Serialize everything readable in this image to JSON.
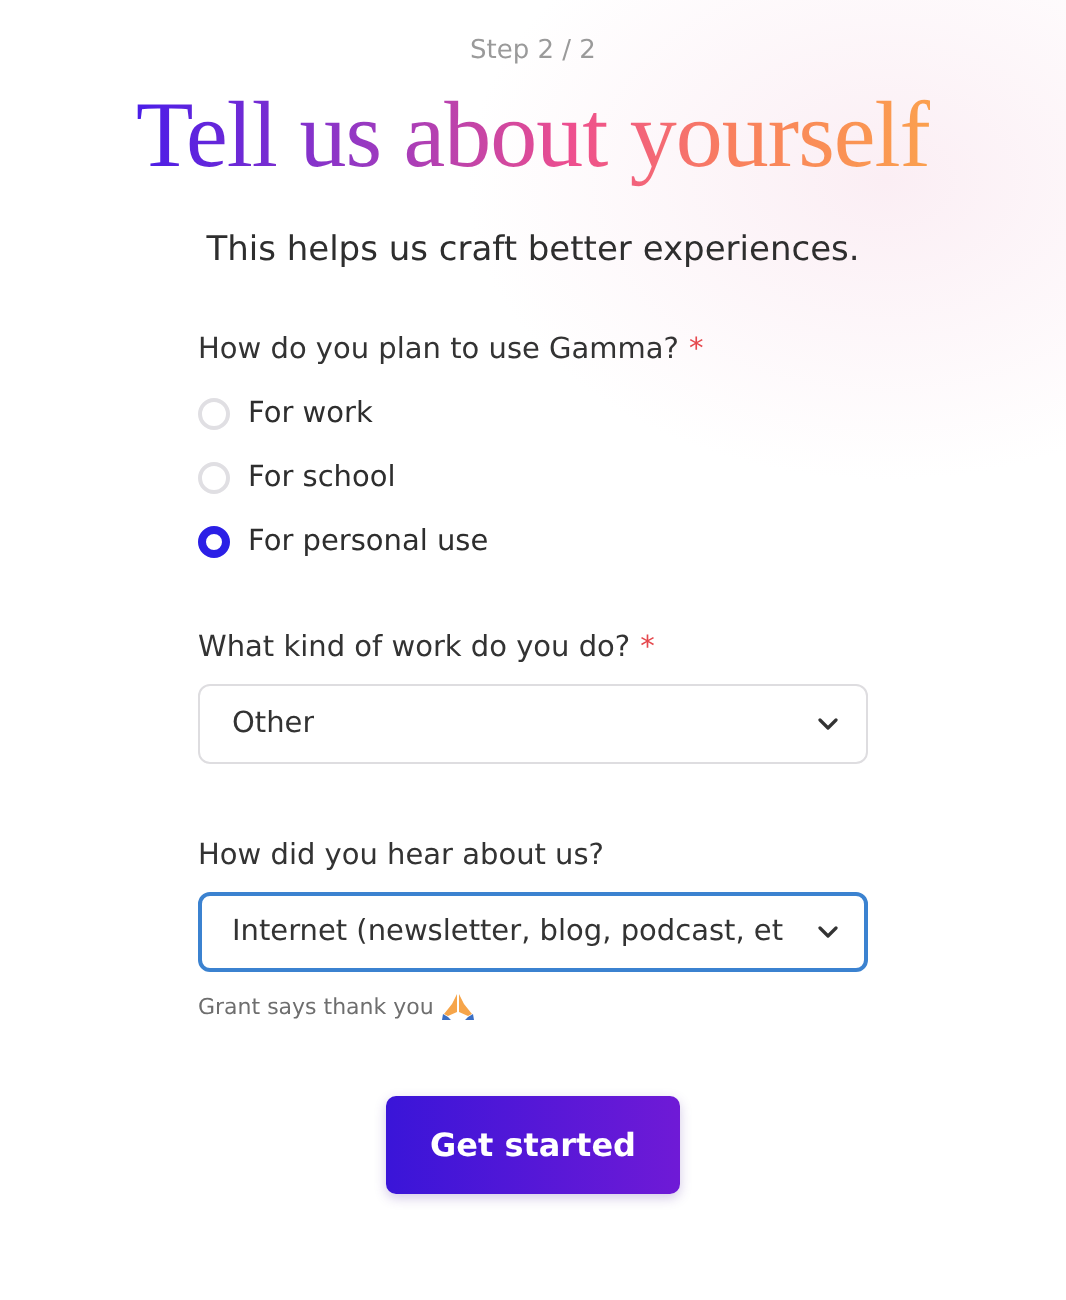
{
  "step": "Step 2 / 2",
  "title": "Tell us about yourself",
  "subtitle": "This helps us craft better experiences.",
  "usage": {
    "label": "How do you plan to use Gamma?",
    "required_mark": "*",
    "options": [
      {
        "label": "For work",
        "selected": false
      },
      {
        "label": "For school",
        "selected": false
      },
      {
        "label": "For personal use",
        "selected": true
      }
    ]
  },
  "work": {
    "label": "What kind of work do you do?",
    "required_mark": "*",
    "value": "Other",
    "focused": false
  },
  "source": {
    "label": "How did you hear about us?",
    "value": "Internet (newsletter, blog, podcast, et",
    "focused": true,
    "note": "Grant says thank you"
  },
  "button": "Get started"
}
